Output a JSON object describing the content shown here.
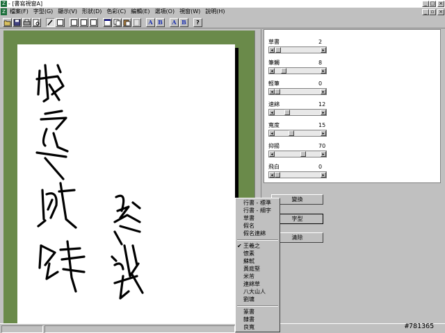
{
  "titlebar": {
    "icon_glyph": "Z",
    "title": "- [書寫視窗A]",
    "minimize": "_",
    "maximize": "□",
    "close": "×"
  },
  "menubar": {
    "doc_icon_glyph": "Z",
    "items": [
      "檔案(F)",
      "字型(G)",
      "顯示(V)",
      "形狀(D)",
      "色彩(C)",
      "編輯(E)",
      "選項(O)",
      "視窗(W)",
      "說明(H)"
    ],
    "minimize": "_",
    "restore": "▫",
    "close": "×"
  },
  "toolbar": {
    "a1": "A",
    "b1": "B",
    "a2": "A",
    "b2": "B",
    "help": "?"
  },
  "properties": [
    {
      "label": "草書",
      "value": "2",
      "level": 0.13
    },
    {
      "label": "筆觸",
      "value": "8",
      "level": 0.25
    },
    {
      "label": "輕筆",
      "value": "0",
      "level": 0.0
    },
    {
      "label": "速綿",
      "value": "12",
      "level": 0.3
    },
    {
      "label": "寬度",
      "value": "15",
      "level": 0.4
    },
    {
      "label": "抑揚",
      "value": "70",
      "level": 0.75
    },
    {
      "label": "飛白",
      "value": "0",
      "level": 0.0
    }
  ],
  "buttons": {
    "transform": "變換",
    "font": "字型",
    "clear": "清除"
  },
  "popup": {
    "group1": [
      "行書 - 標準",
      "行書 - 細字",
      "草書",
      "假名",
      "假名連綿"
    ],
    "group2": [
      "王羲之",
      "懷素",
      "蘇軾",
      "黃庭堅",
      "米芾",
      "連綿草",
      "八大山人",
      "劉墉"
    ],
    "checked": "王羲之",
    "group3": [
      "篆書",
      "隸書",
      "良寬"
    ]
  },
  "watermark": "#781365",
  "colors": {
    "background": "#6a8a4a",
    "paper": "#ffffff",
    "ink": "#000000",
    "chrome": "#c0c0c0"
  }
}
